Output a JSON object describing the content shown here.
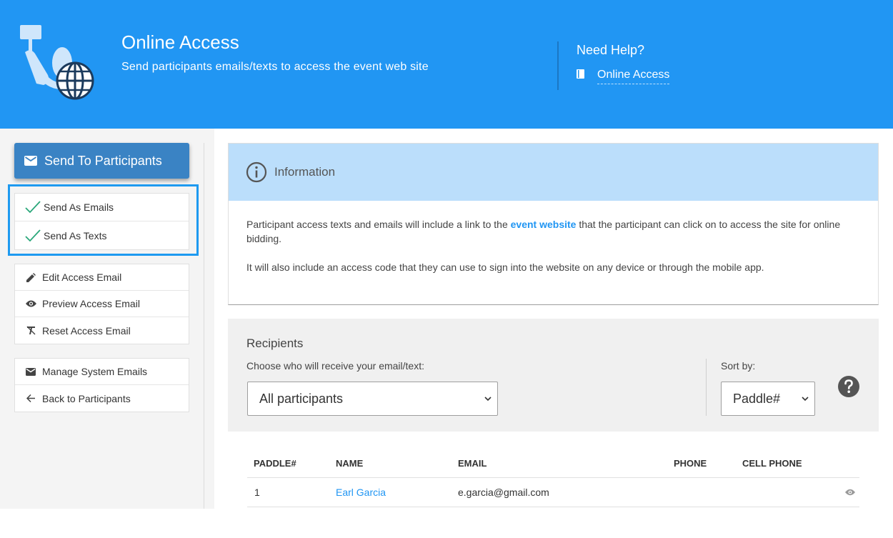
{
  "header": {
    "title": "Online Access",
    "subtitle": "Send participants emails/texts to access the event web site",
    "help_title": "Need Help?",
    "help_link": "Online Access",
    "background_color": "#2196f3"
  },
  "sidebar": {
    "send_button": {
      "label": "Send To Participants",
      "icon": "email-icon"
    },
    "send_options": [
      {
        "label": "Send As Emails",
        "icon": "check-icon"
      },
      {
        "label": "Send As Texts",
        "icon": "check-icon"
      }
    ],
    "edit_group": [
      {
        "label": "Edit Access Email",
        "icon": "pencil-icon"
      },
      {
        "label": "Preview Access Email",
        "icon": "eye-icon"
      },
      {
        "label": "Reset Access Email",
        "icon": "clear-format-icon"
      }
    ],
    "nav_group": [
      {
        "label": "Manage System Emails",
        "icon": "email-icon"
      },
      {
        "label": "Back to Participants",
        "icon": "arrow-left-icon"
      }
    ]
  },
  "info": {
    "heading": "Information",
    "para1_before": "Participant access texts and emails will include a link to the ",
    "para1_link": "event website",
    "para1_after": " that the participant can click on to access the site for online bidding.",
    "para2": "It will also include an access code that they can use to sign into the website on any device or through the mobile app."
  },
  "recipients": {
    "title": "Recipients",
    "choose_label": "Choose who will receive your email/text:",
    "choose_value": "All participants",
    "sort_label": "Sort by:",
    "sort_value": "Paddle#"
  },
  "table": {
    "columns": [
      "PADDLE#",
      "NAME",
      "EMAIL",
      "PHONE",
      "CELL PHONE"
    ],
    "rows": [
      {
        "paddle": "1",
        "name": "Earl Garcia",
        "email": "e.garcia@gmail.com",
        "phone": "",
        "cell": ""
      }
    ]
  }
}
